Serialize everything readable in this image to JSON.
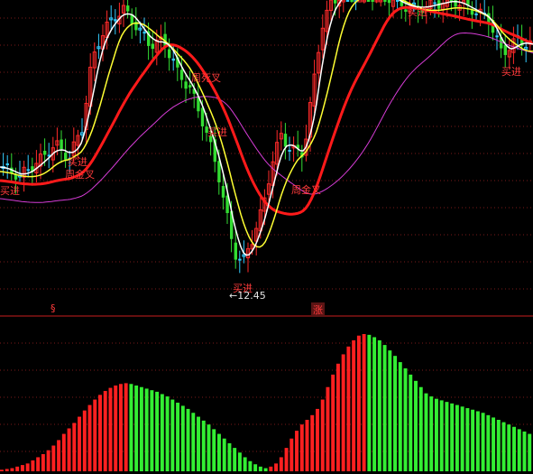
{
  "chart_data": [
    {
      "type": "candlestick",
      "annotations": [
        "买进",
        "周金叉",
        "买进",
        "周死叉",
        "买进",
        "买进",
        "周金叉",
        "买进",
        "买进"
      ],
      "price_label": "12.45",
      "colors": {
        "up": "#ff2a2a",
        "down": "#33dd33",
        "doji": "#33ccff",
        "ma_short": "#ffffff",
        "ma_mid": "#ffff33",
        "ma_long": "#ff1a1a",
        "ma_extra": "#d63cd6"
      }
    },
    {
      "type": "bar",
      "markers": [
        "§",
        "涨"
      ],
      "colors": {
        "rising": "#ff2020",
        "falling": "#33ee33"
      },
      "values": [
        2,
        3,
        4,
        6,
        8,
        10,
        14,
        18,
        22,
        27,
        33,
        40,
        48,
        55,
        62,
        70,
        78,
        85,
        92,
        98,
        103,
        107,
        110,
        112,
        113,
        112,
        110,
        108,
        106,
        104,
        102,
        99,
        96,
        92,
        88,
        84,
        80,
        75,
        70,
        65,
        60,
        54,
        48,
        42,
        36,
        30,
        24,
        18,
        13,
        9,
        6,
        4,
        6,
        10,
        18,
        30,
        42,
        52,
        60,
        66,
        72,
        80,
        92,
        108,
        124,
        138,
        150,
        160,
        168,
        174,
        176,
        175,
        172,
        168,
        162,
        155,
        148,
        140,
        132,
        124,
        116,
        108,
        100,
        96,
        93,
        91,
        89,
        87,
        85,
        83,
        81,
        79,
        77,
        75,
        72,
        69,
        66,
        63,
        60,
        57,
        54,
        51,
        48
      ]
    }
  ]
}
